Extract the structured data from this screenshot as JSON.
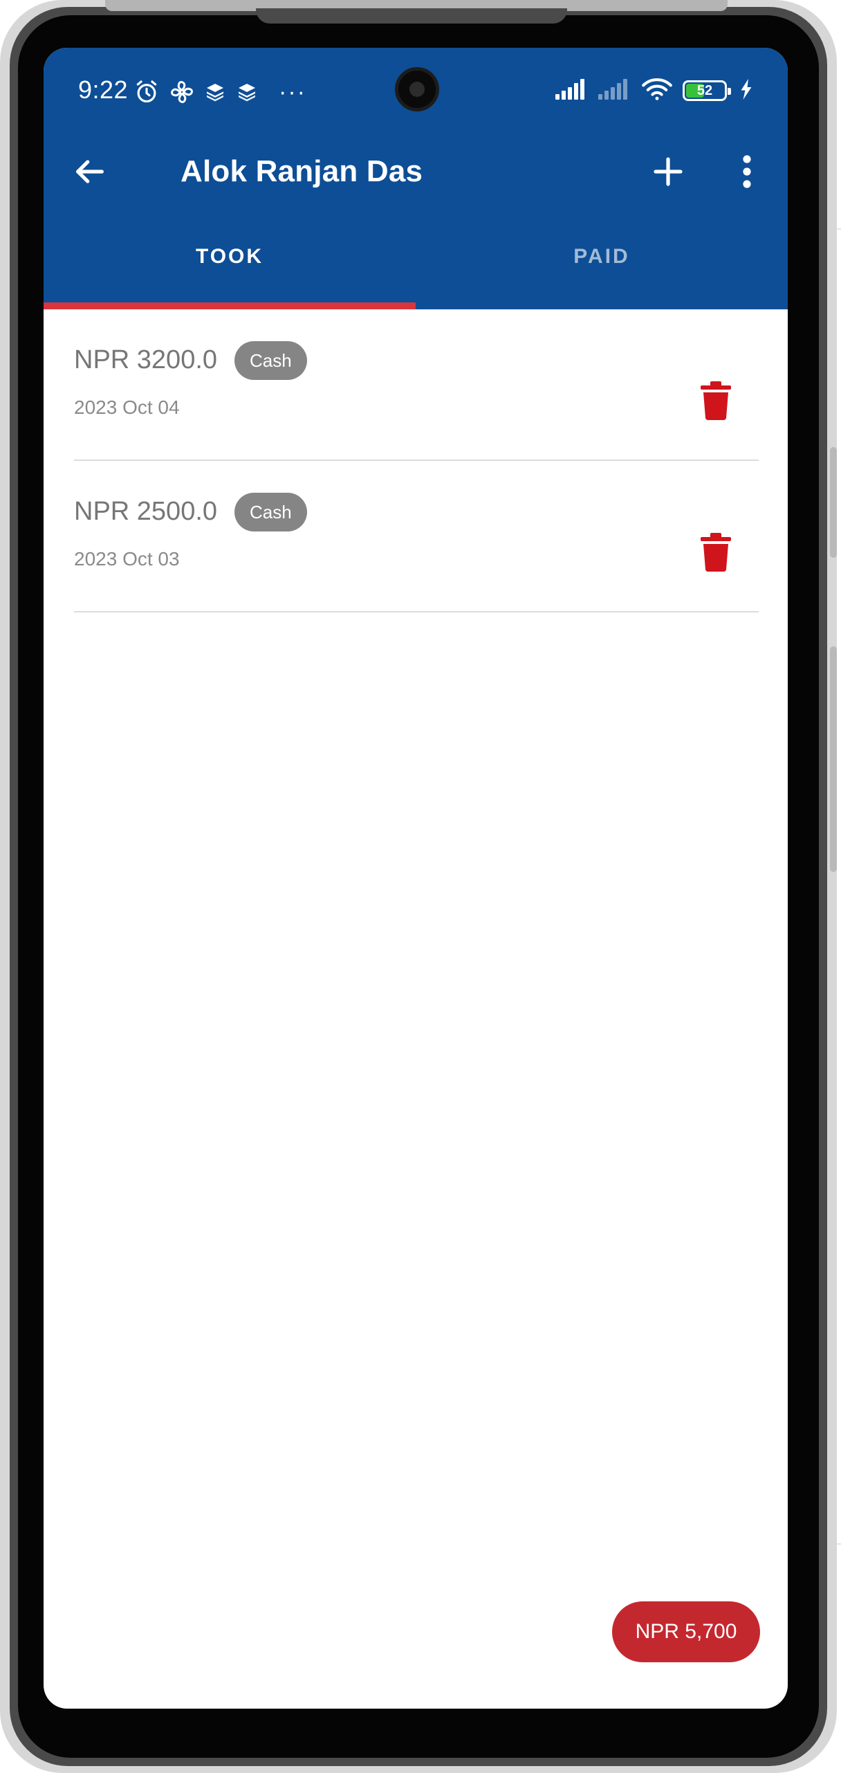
{
  "status_bar": {
    "time": "9:22",
    "overflow_dots": "···",
    "battery_percent": "52",
    "battery_level": 0.52,
    "battery_color": "#38c23b",
    "left_icons": [
      "alarm-icon",
      "fan-icon",
      "layers-icon",
      "layers-icon"
    ],
    "right_icons": [
      "signal-icon",
      "signal-weak-icon",
      "wifi-icon",
      "battery-icon",
      "charging-icon"
    ]
  },
  "toolbar": {
    "title": "Alok Ranjan Das",
    "back_icon": "arrow-left-icon",
    "add_icon": "plus-icon",
    "more_icon": "more-vertical-icon"
  },
  "tabs": [
    {
      "label": "TOOK",
      "active": true
    },
    {
      "label": "PAID",
      "active": false
    }
  ],
  "entries": [
    {
      "amount": "NPR 3200.0",
      "method": "Cash",
      "date": "2023 Oct 04",
      "delete_icon": "trash-icon"
    },
    {
      "amount": "NPR 2500.0",
      "method": "Cash",
      "date": "2023 Oct 03",
      "delete_icon": "trash-icon"
    }
  ],
  "total": {
    "label": "NPR 5,700"
  },
  "colors": {
    "primary": "#0d4e96",
    "tab_indicator": "#d8363c",
    "delete": "#d0141c",
    "chip": "#858585",
    "total_pill": "#c4282f"
  }
}
